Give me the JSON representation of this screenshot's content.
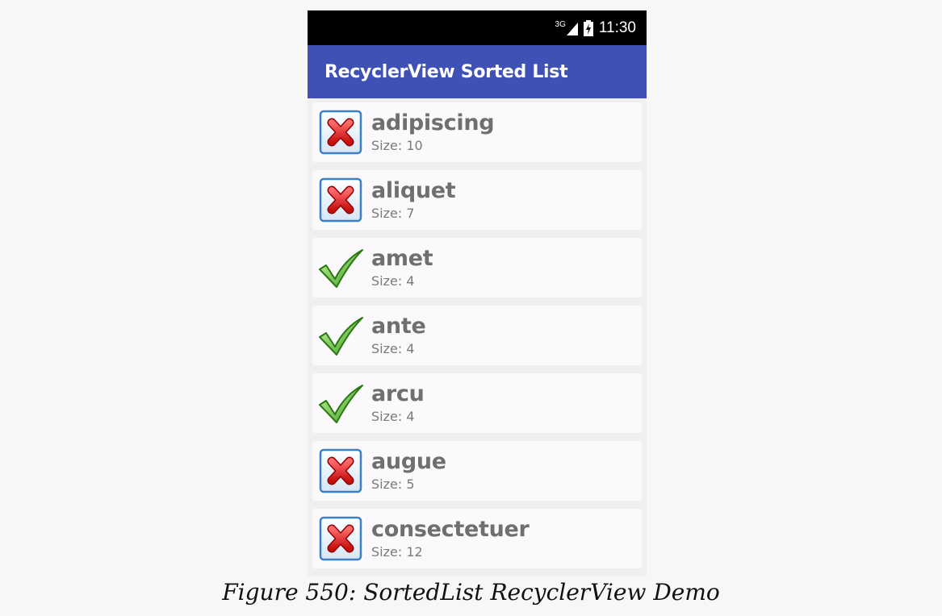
{
  "status_bar": {
    "network": "3G",
    "time": "11:30"
  },
  "app_bar": {
    "title": "RecyclerView Sorted List"
  },
  "rows": [
    {
      "word": "adipiscing",
      "size": "Size: 10",
      "icon": "cross-icon"
    },
    {
      "word": "aliquet",
      "size": "Size: 7",
      "icon": "cross-icon"
    },
    {
      "word": "amet",
      "size": "Size: 4",
      "icon": "check-icon"
    },
    {
      "word": "ante",
      "size": "Size: 4",
      "icon": "check-icon"
    },
    {
      "word": "arcu",
      "size": "Size: 4",
      "icon": "check-icon"
    },
    {
      "word": "augue",
      "size": "Size: 5",
      "icon": "cross-icon"
    },
    {
      "word": "consectetuer",
      "size": "Size: 12",
      "icon": "cross-icon"
    }
  ],
  "caption": "Figure 550: SortedList RecyclerView Demo",
  "colors": {
    "app_bar": "#3f51b5",
    "status_bar": "#000000",
    "row_background": "#fcf9fd",
    "list_background": "#efefef"
  }
}
